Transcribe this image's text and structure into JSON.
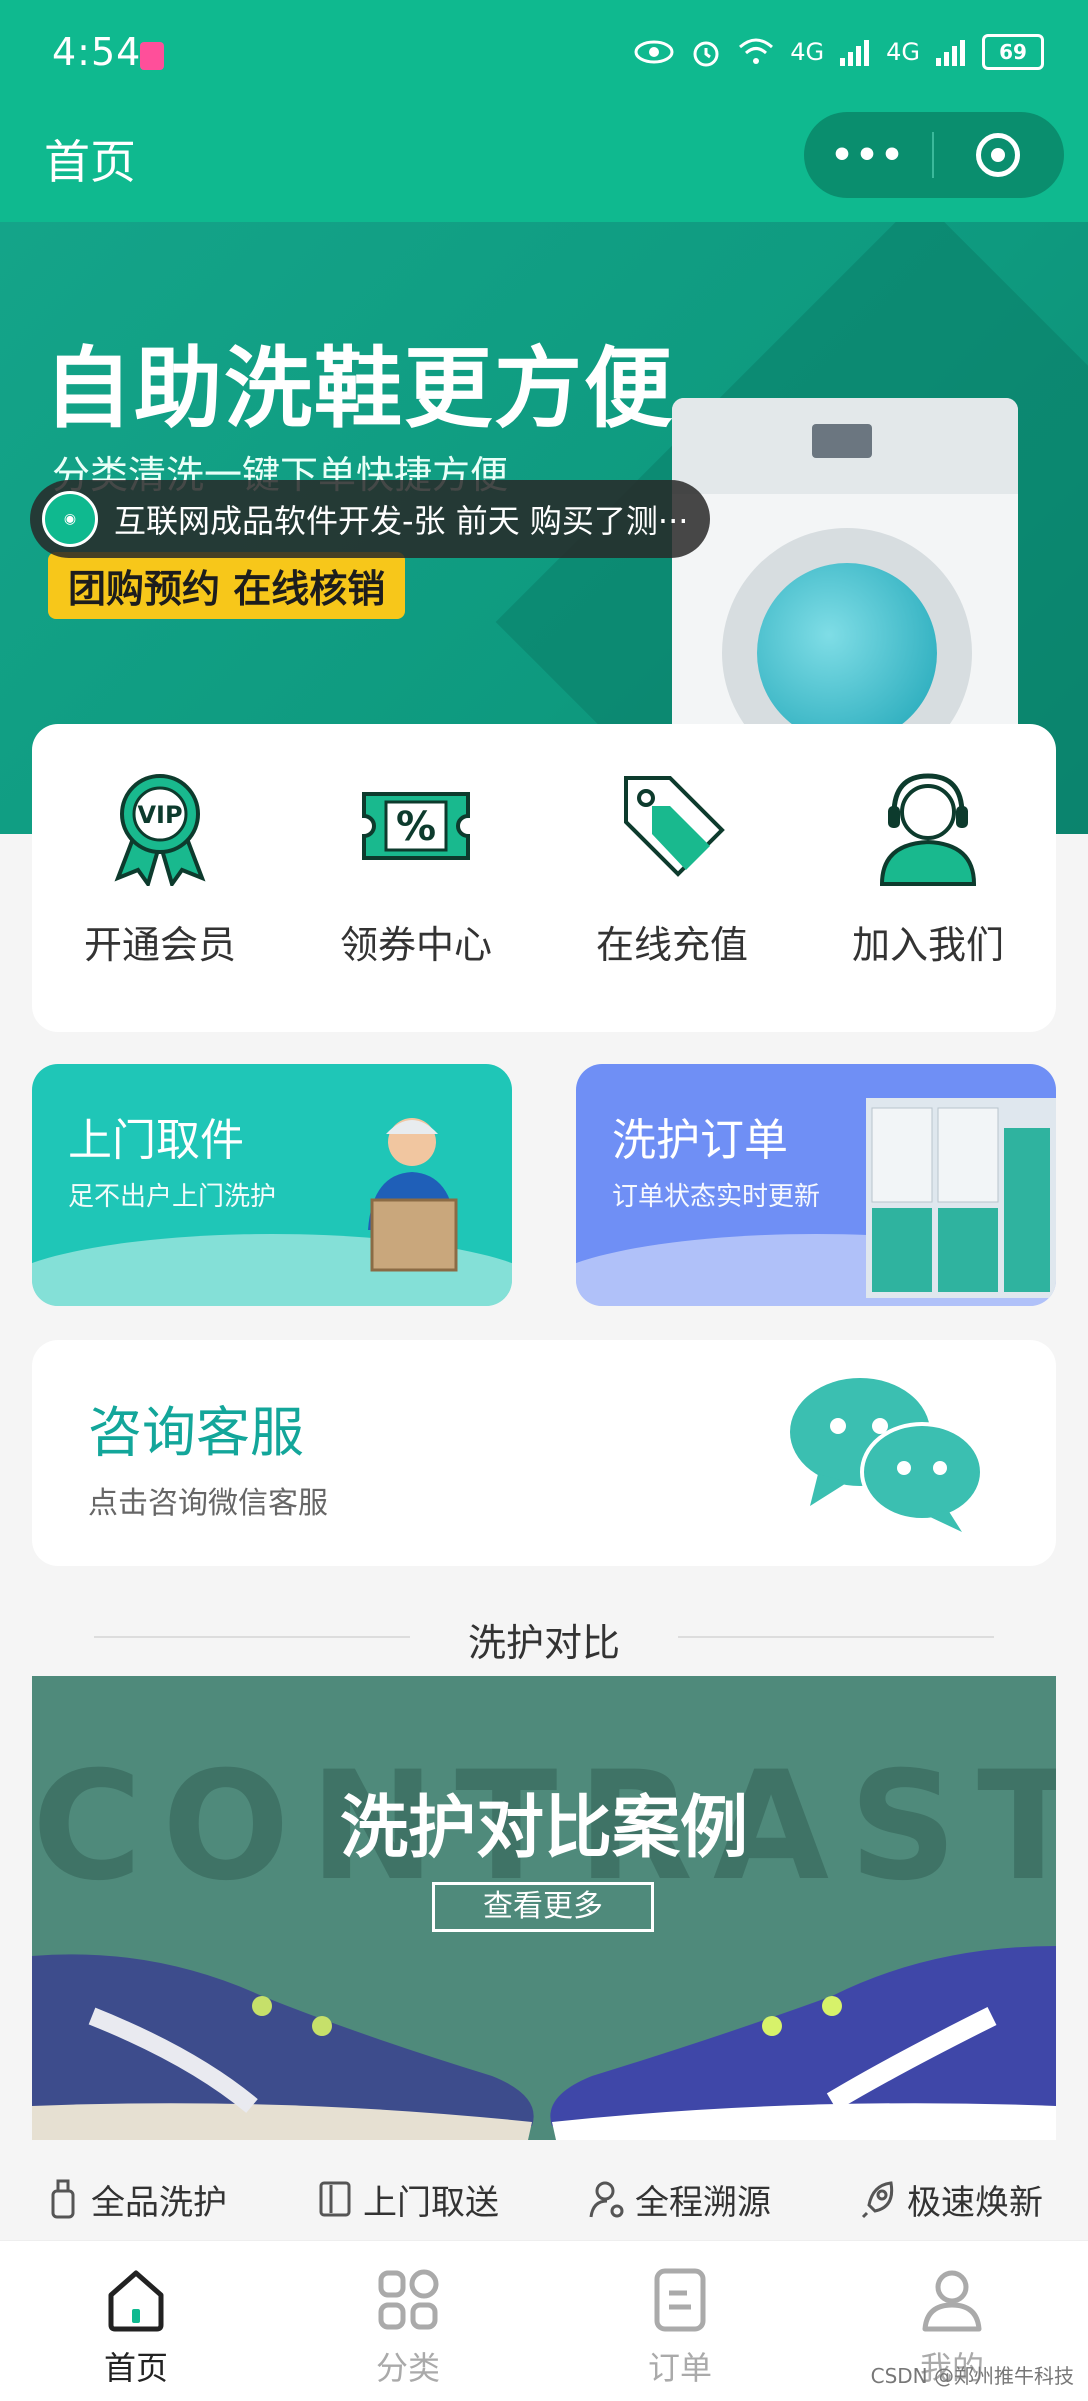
{
  "status": {
    "time": "4:54",
    "battery": "69",
    "net1": "4G",
    "net2": "4G"
  },
  "header": {
    "title": "首页",
    "more": "•••"
  },
  "banner": {
    "title": "自助洗鞋更方便",
    "subtitle": "分类清洗一键下单快捷方便",
    "tag": "团购预约  在线核销",
    "toast": "互联网成品软件开发-张 前天 购买了测···"
  },
  "menu": [
    {
      "label": "开通会员",
      "icon": "vip-ribbon-icon"
    },
    {
      "label": "领券中心",
      "icon": "coupon-icon"
    },
    {
      "label": "在线充值",
      "icon": "price-tag-icon"
    },
    {
      "label": "加入我们",
      "icon": "customer-service-icon"
    }
  ],
  "promos": [
    {
      "title": "上门取件",
      "subtitle": "足不出户上门洗护"
    },
    {
      "title": "洗护订单",
      "subtitle": "订单状态实时更新"
    }
  ],
  "consult": {
    "title": "咨询客服",
    "subtitle": "点击咨询微信客服"
  },
  "section": {
    "title": "洗护对比"
  },
  "contrast": {
    "bg_text": "CONTRAST",
    "title": "洗护对比案例",
    "button": "查看更多"
  },
  "features": [
    "全品洗护",
    "上门取送",
    "全程溯源",
    "极速焕新"
  ],
  "tabs": [
    "首页",
    "分类",
    "订单",
    "我的"
  ],
  "watermark": "CSDN @郑州推牛科技",
  "colors": {
    "brand": "#0fb98f",
    "teal": "#1fc6b7",
    "blue": "#6f8ff5",
    "accent_yellow": "#f7c71a"
  }
}
